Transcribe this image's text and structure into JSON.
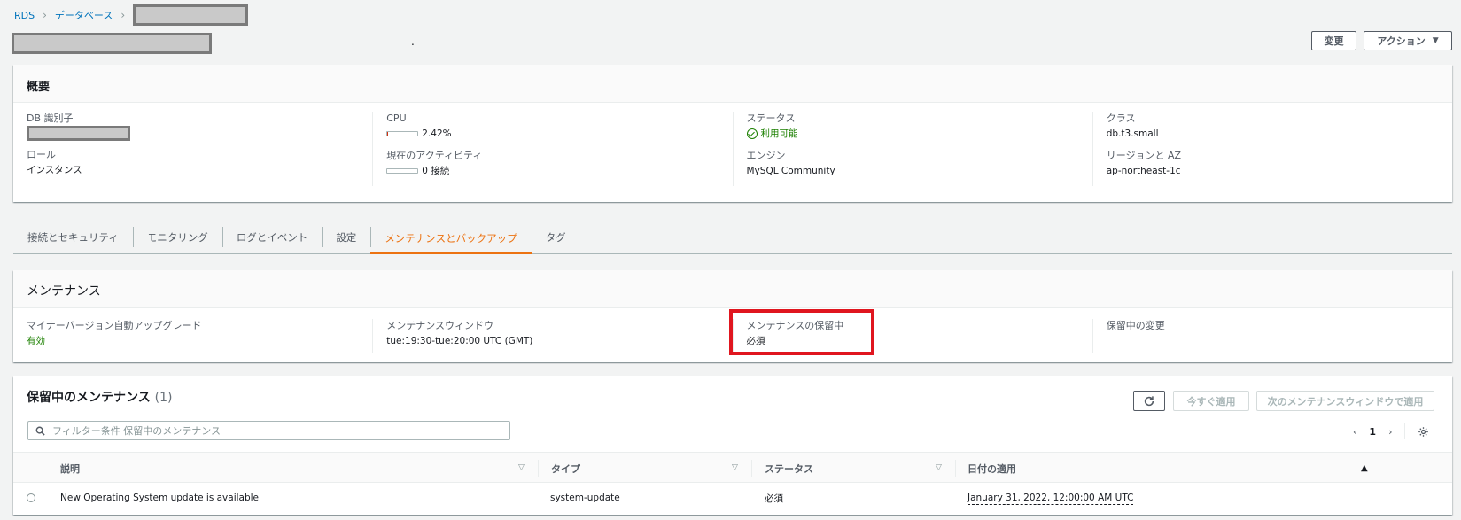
{
  "breadcrumb": {
    "items": [
      "RDS",
      "データベース"
    ]
  },
  "header": {
    "edit_label": "変更",
    "actions_label": "アクション"
  },
  "summary": {
    "title": "概要",
    "db_id_label": "DB 識別子",
    "cpu_label": "CPU",
    "cpu_value": "2.42%",
    "cpu_percent": 2.42,
    "status_label": "ステータス",
    "status_value": "利用可能",
    "class_label": "クラス",
    "class_value": "db.t3.small",
    "role_label": "ロール",
    "role_value": "インスタンス",
    "activity_label": "現在のアクティビティ",
    "activity_value": "0 接続",
    "engine_label": "エンジン",
    "engine_value": "MySQL Community",
    "region_label": "リージョンと AZ",
    "region_value": "ap-northeast-1c"
  },
  "tabs": [
    {
      "label": "接続とセキュリティ"
    },
    {
      "label": "モニタリング"
    },
    {
      "label": "ログとイベント"
    },
    {
      "label": "設定"
    },
    {
      "label": "メンテナンスとバックアップ",
      "active": true
    },
    {
      "label": "タグ"
    }
  ],
  "maintenance": {
    "title": "メンテナンス",
    "auto_upgrade_label": "マイナーバージョン自動アップグレード",
    "auto_upgrade_value": "有効",
    "window_label": "メンテナンスウィンドウ",
    "window_value": "tue:19:30-tue:20:00 UTC (GMT)",
    "pending_label": "メンテナンスの保留中",
    "pending_value": "必須",
    "pending_changes_label": "保留中の変更"
  },
  "pending": {
    "title": "保留中のメンテナンス",
    "count": "(1)",
    "apply_now_label": "今すぐ適用",
    "apply_next_label": "次のメンテナンスウィンドウで適用",
    "filter_placeholder": "フィルター条件 保留中のメンテナンス",
    "page": "1",
    "columns": [
      "説明",
      "タイプ",
      "ステータス",
      "日付の適用"
    ],
    "rows": [
      {
        "description": "New Operating System update is available",
        "type": "system-update",
        "status": "必須",
        "date": "January 31, 2022, 12:00:00 AM UTC"
      }
    ]
  },
  "colors": {
    "accent": "#ec7211",
    "link": "#0073bb",
    "success": "#1d8102",
    "highlight": "#e0161f"
  }
}
